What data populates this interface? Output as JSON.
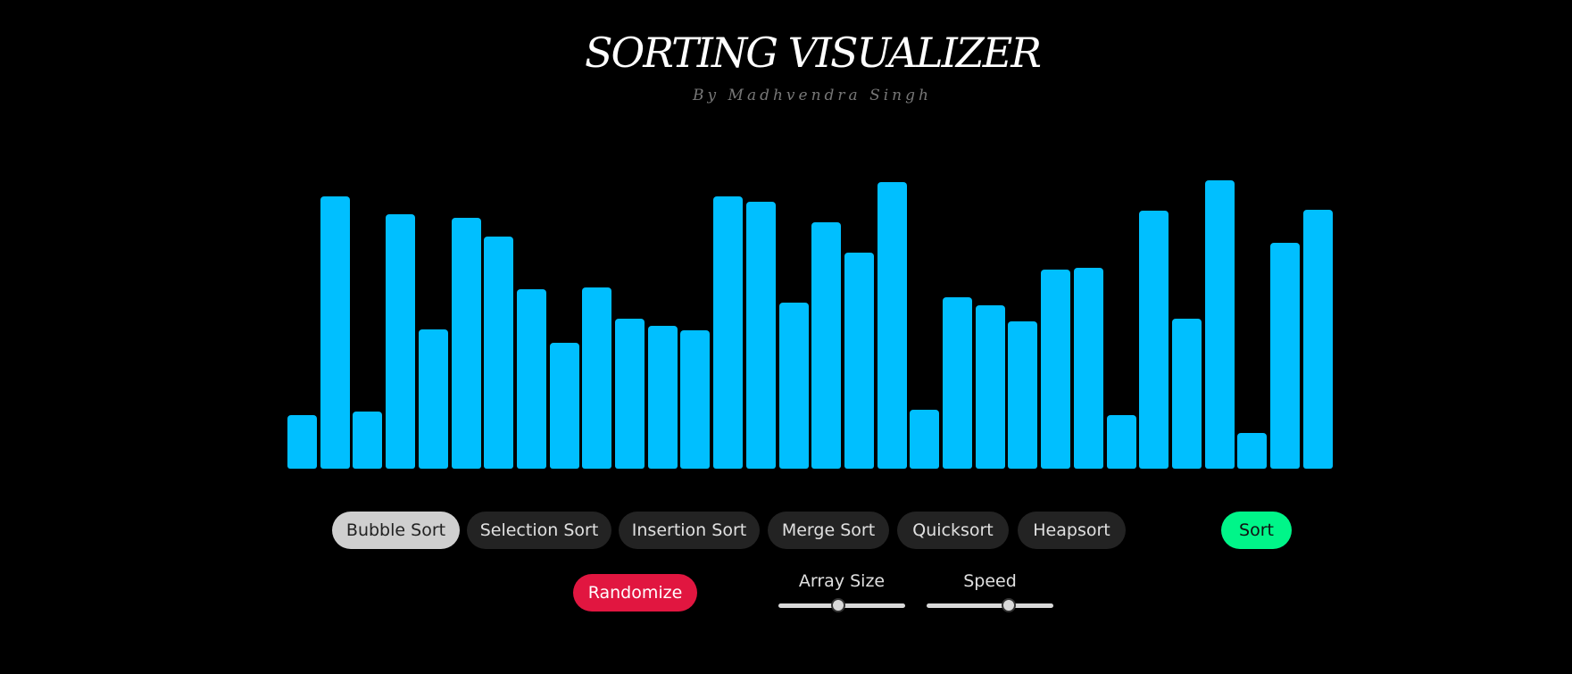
{
  "header": {
    "title": "SORTING VISUALIZER",
    "subtitle": "By Madhvendra Singh"
  },
  "colors": {
    "bar": "#00bfff",
    "active_algorithm": "#cfcfcf",
    "sort_button": "#00f589",
    "randomize_button": "#e11640"
  },
  "array": {
    "bar_values": [
      55,
      282,
      59,
      263,
      144,
      259,
      240,
      186,
      130,
      187,
      155,
      148,
      143,
      282,
      276,
      172,
      255,
      223,
      296,
      61,
      177,
      169,
      152,
      206,
      208,
      55,
      267,
      155,
      298,
      37,
      234,
      268
    ]
  },
  "algorithms": {
    "items": [
      {
        "label": "Bubble Sort",
        "active": true
      },
      {
        "label": "Selection Sort",
        "active": false
      },
      {
        "label": "Insertion Sort",
        "active": false
      },
      {
        "label": "Merge Sort",
        "active": false
      },
      {
        "label": "Quicksort",
        "active": false
      },
      {
        "label": "Heapsort",
        "active": false
      }
    ]
  },
  "controls": {
    "sort_label": "Sort",
    "randomize_label": "Randomize",
    "array_size": {
      "label": "Array Size",
      "value_fraction": 0.47
    },
    "speed": {
      "label": "Speed",
      "value_fraction": 0.65
    }
  }
}
